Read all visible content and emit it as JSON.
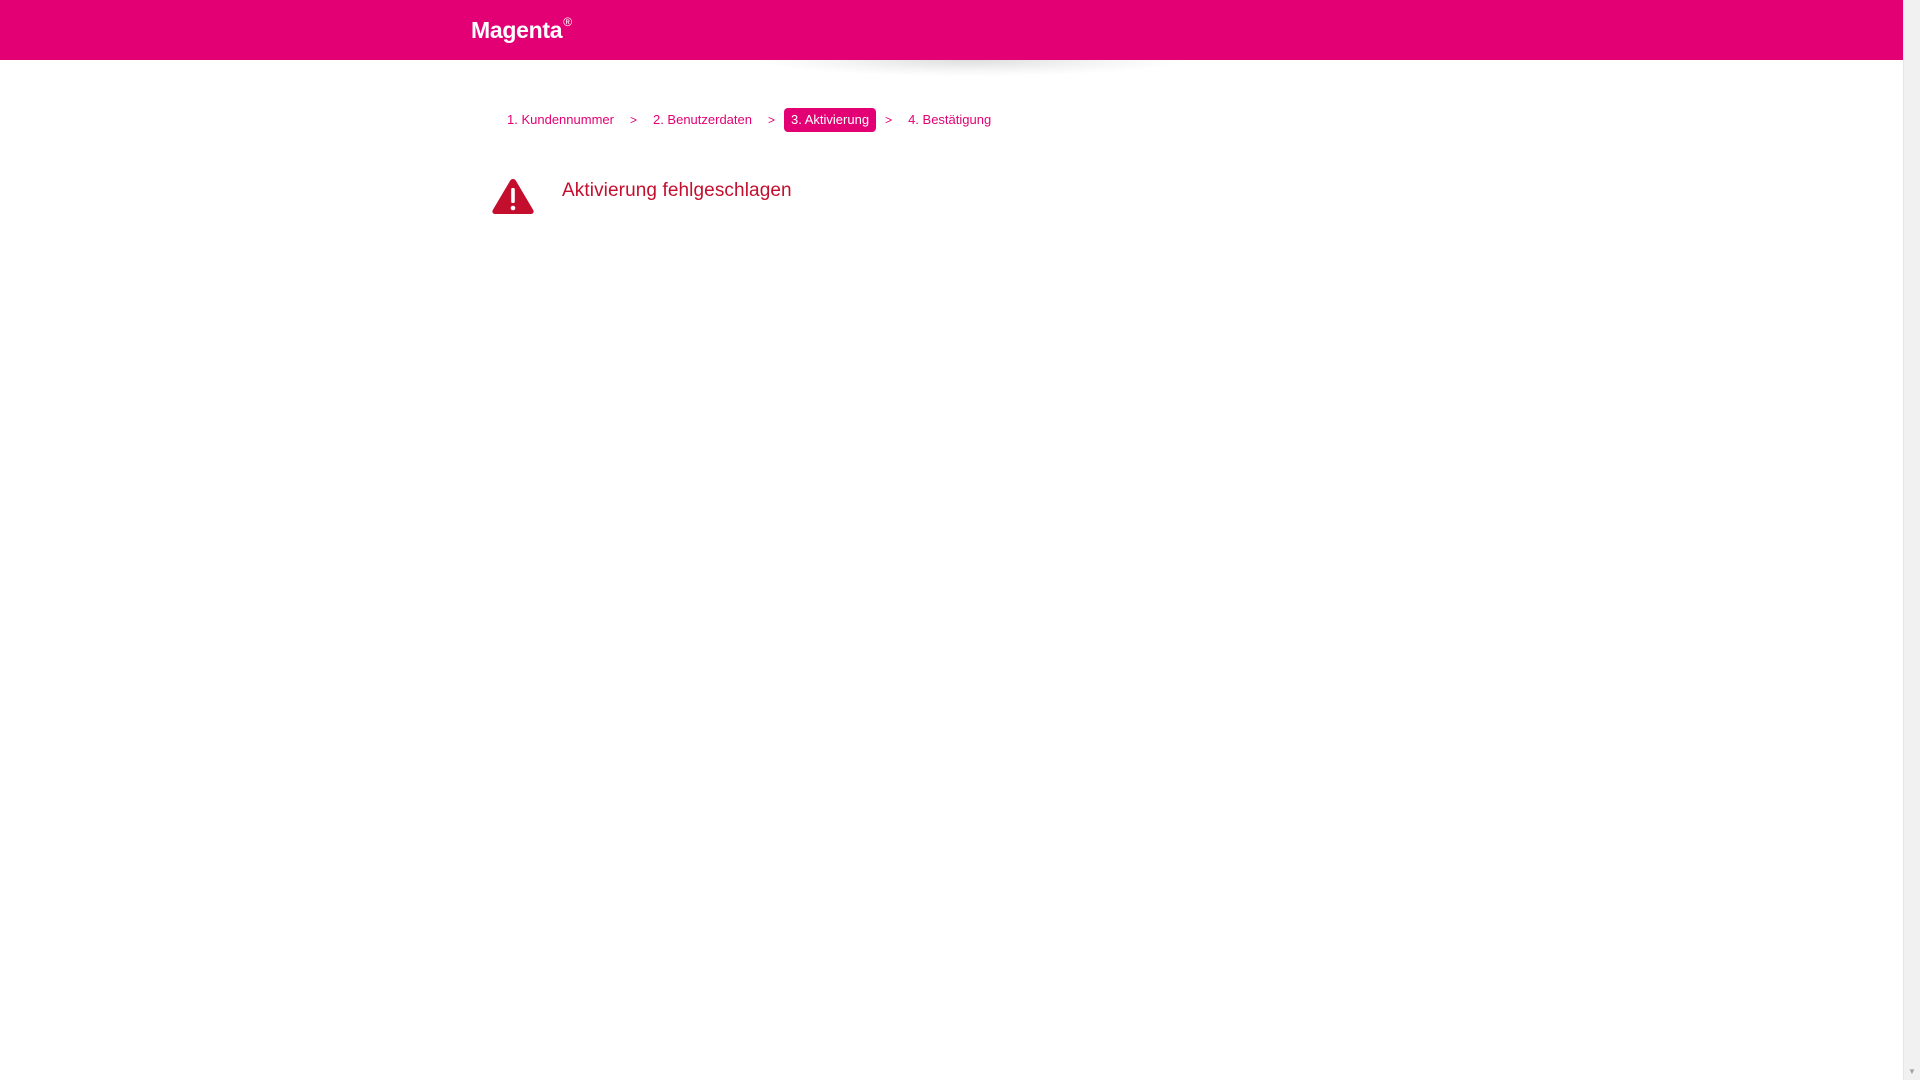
{
  "header": {
    "brand": "Magenta",
    "brand_mark": "®",
    "color": "#e20074"
  },
  "steps": [
    {
      "label": "1. Kundennummer",
      "active": false
    },
    {
      "label": "2. Benutzerdaten",
      "active": false
    },
    {
      "label": "3. Aktivierung",
      "active": true
    },
    {
      "label": "4. Bestätigung",
      "active": false
    }
  ],
  "step_separator": ">",
  "alert": {
    "icon": "warning-triangle-icon",
    "title": "Aktivierung fehlgeschlagen",
    "color": "#c40e2e"
  },
  "scrollbar": {
    "down_arrow": "▼"
  }
}
